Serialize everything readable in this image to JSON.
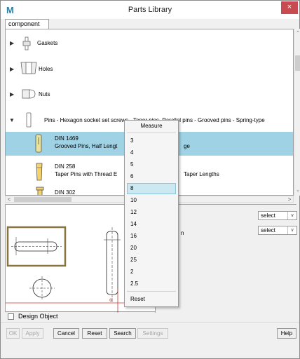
{
  "window": {
    "app_logo": "M",
    "title": "Parts Library",
    "close": "×"
  },
  "tabs": [
    {
      "label": "component"
    }
  ],
  "tree": {
    "rows": [
      {
        "label": "Gaskets",
        "icon": "gasket-icon"
      },
      {
        "label": "Holes",
        "icon": "hole-icon"
      },
      {
        "label": "Nuts",
        "icon": "nut-icon"
      },
      {
        "label": "Pins - Hexagon socket set screws - Taper pins, Parallel pins - Grooved pins - Spring-type",
        "icon": "pin-icon",
        "expanded": true
      },
      {
        "title": "DIN 1469",
        "desc": "Grooved Pins, Half Lengt",
        "desc_tail": "ge",
        "icon": "grooved-pin-icon",
        "selected": true
      },
      {
        "title": "DIN 258",
        "desc": "Taper Pins with Thread E",
        "desc_tail": "Taper Lengths",
        "icon": "taper-pin-icon"
      },
      {
        "title": "DIN 302",
        "icon": "pin-302-icon"
      }
    ]
  },
  "props": {
    "label_partial": "n",
    "select1": "select",
    "select2": "select"
  },
  "preview": {
    "dimension_label": "α"
  },
  "design_object": {
    "label": "Design Object",
    "checked": false
  },
  "buttons": [
    {
      "label": "OK",
      "enabled": false
    },
    {
      "label": "Apply",
      "enabled": false
    },
    {
      "label": "Cancel",
      "enabled": true
    },
    {
      "label": "Reset",
      "enabled": true
    },
    {
      "label": "Search",
      "enabled": true
    },
    {
      "label": "Settings",
      "enabled": false
    },
    {
      "label": "Help",
      "enabled": true
    }
  ],
  "measure_menu": {
    "header": "Measure",
    "items": [
      "3",
      "4",
      "5",
      "6",
      "8",
      "10",
      "12",
      "14",
      "16",
      "20",
      "25",
      "2",
      "2.5"
    ],
    "selected": "8",
    "reset_label": "Reset"
  },
  "colors": {
    "selection": "#9fd2e4",
    "logo": "#2c7fa6",
    "close": "#c74b50",
    "frame": "#8b7340"
  }
}
